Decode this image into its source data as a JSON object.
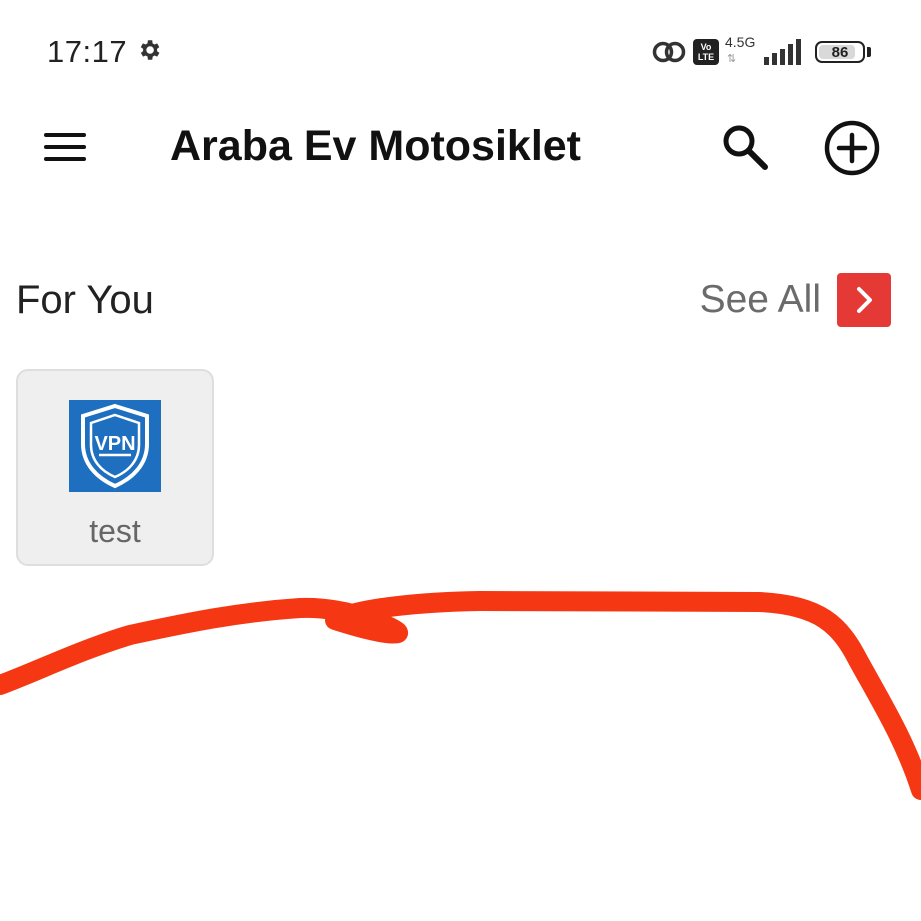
{
  "status_bar": {
    "time": "17:17",
    "network_label_top": "Vo",
    "network_label_bottom": "LTE",
    "network_type": "4.5G",
    "network_arrows": "⇅",
    "battery_level": "86",
    "icons": [
      "gear-icon",
      "loop-icon",
      "volte-icon",
      "signal-icon",
      "battery-icon"
    ]
  },
  "app_bar": {
    "title": "Araba Ev Motosiklet",
    "icons": [
      "menu-icon",
      "search-icon",
      "add-circle-icon"
    ]
  },
  "section": {
    "title": "For You",
    "see_all_label": "See All",
    "see_all_icon": "chevron-right-icon",
    "accent_color": "#e53935"
  },
  "apps": [
    {
      "name": "test",
      "icon": "vpn-shield-icon",
      "icon_text": "VPN",
      "icon_background": "#1e6fc0"
    }
  ],
  "annotation": {
    "type": "freehand-stroke",
    "color": "#f53813"
  }
}
